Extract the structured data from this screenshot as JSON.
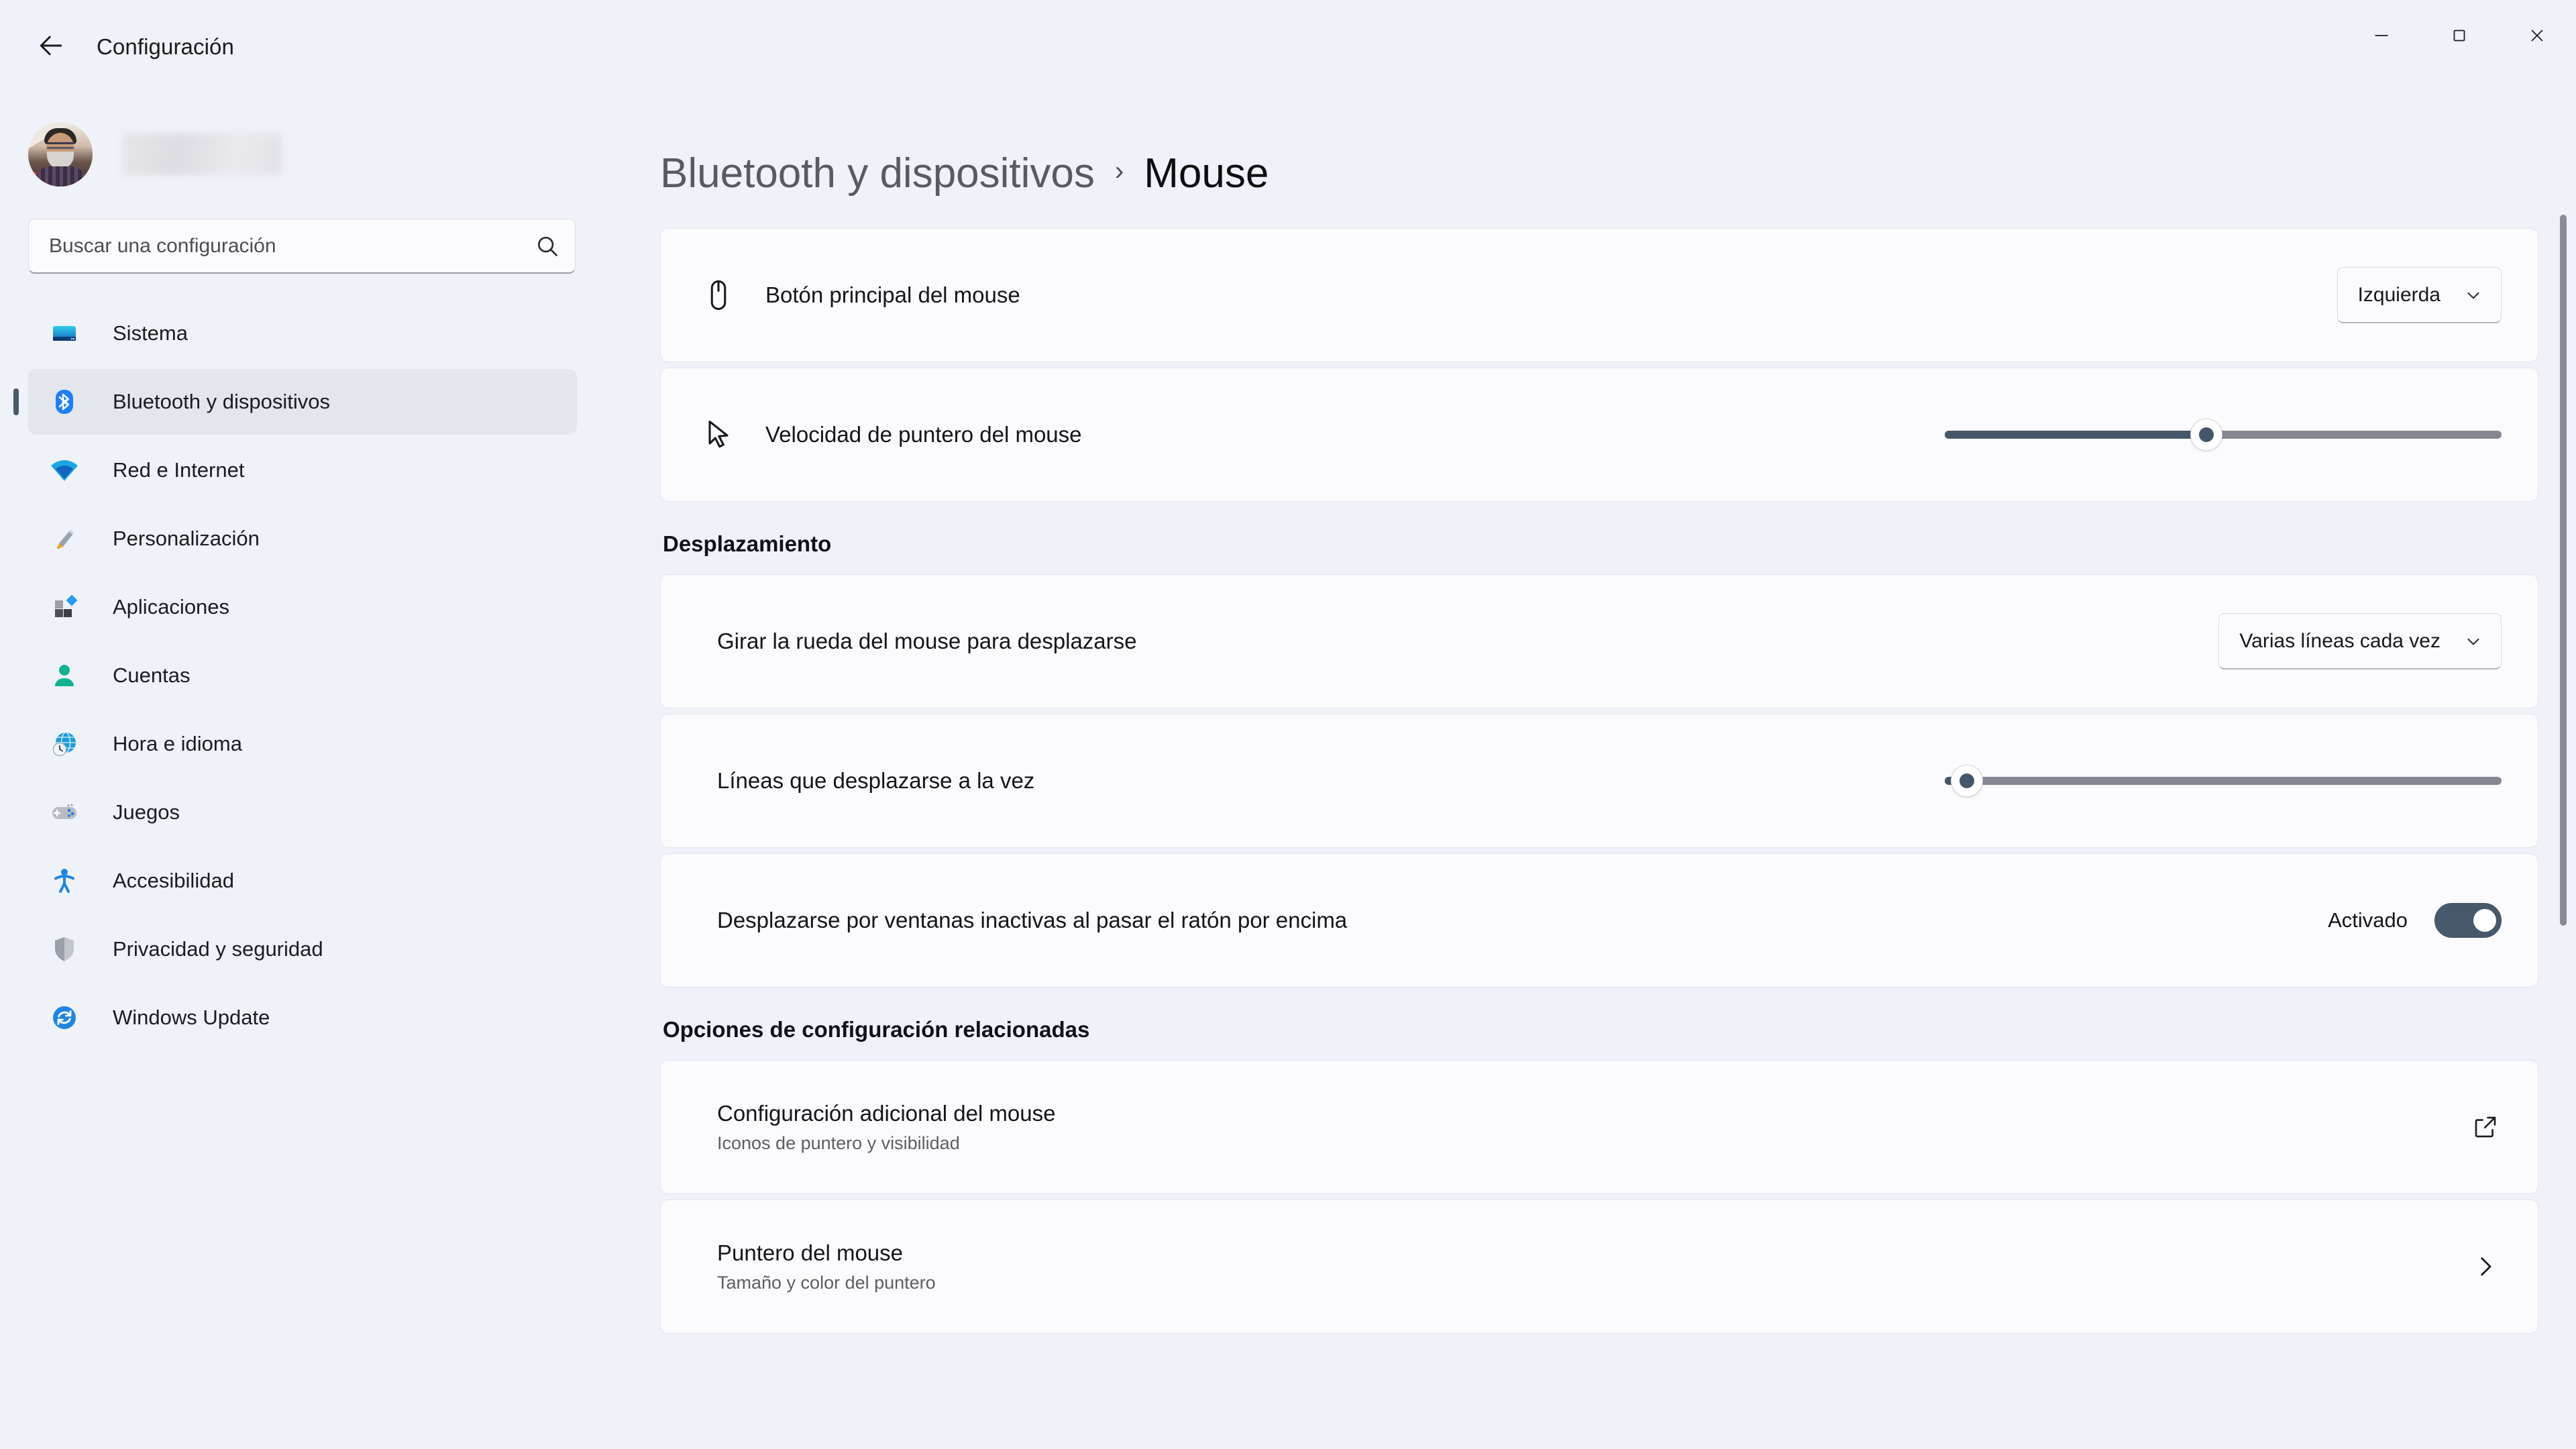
{
  "window": {
    "app_title": "Configuración",
    "back_icon": "arrow-left-icon",
    "controls": {
      "minimize": "minimize-icon",
      "maximize": "maximize-icon",
      "close": "close-icon"
    }
  },
  "sidebar": {
    "profile": {
      "avatar": "user-avatar",
      "name_redacted": ""
    },
    "search": {
      "placeholder": "Buscar una configuración",
      "value": "",
      "icon": "search-icon"
    },
    "items": [
      {
        "label": "Sistema",
        "icon": "system-monitor-icon",
        "active": false
      },
      {
        "label": "Bluetooth y dispositivos",
        "icon": "bluetooth-icon",
        "active": true
      },
      {
        "label": "Red e Internet",
        "icon": "wifi-icon",
        "active": false
      },
      {
        "label": "Personalización",
        "icon": "paintbrush-icon",
        "active": false
      },
      {
        "label": "Aplicaciones",
        "icon": "apps-icon",
        "active": false
      },
      {
        "label": "Cuentas",
        "icon": "account-person-icon",
        "active": false
      },
      {
        "label": "Hora e idioma",
        "icon": "clock-globe-icon",
        "active": false
      },
      {
        "label": "Juegos",
        "icon": "gamepad-icon",
        "active": false
      },
      {
        "label": "Accesibilidad",
        "icon": "accessibility-person-icon",
        "active": false
      },
      {
        "label": "Privacidad y seguridad",
        "icon": "shield-icon",
        "active": false
      },
      {
        "label": "Windows Update",
        "icon": "update-refresh-icon",
        "active": false
      }
    ]
  },
  "main": {
    "breadcrumb": {
      "parent": "Bluetooth y dispositivos",
      "separator": "›",
      "current": "Mouse"
    },
    "primary_button": {
      "label": "Botón principal del mouse",
      "icon": "mouse-icon",
      "dropdown_value": "Izquierda",
      "dropdown_icon": "chevron-down-icon"
    },
    "pointer_speed": {
      "label": "Velocidad de puntero del mouse",
      "icon": "cursor-arrow-icon",
      "slider_percent": 47
    },
    "scroll_section": {
      "title": "Desplazamiento",
      "wheel_scroll": {
        "label": "Girar la rueda del mouse para desplazarse",
        "dropdown_value": "Varias líneas cada vez",
        "dropdown_icon": "chevron-down-icon"
      },
      "lines_at_a_time": {
        "label": "Líneas que desplazarse a la vez",
        "slider_percent": 4
      },
      "inactive_windows": {
        "label": "Desplazarse por ventanas inactivas al pasar el ratón por encima",
        "toggle_state_label": "Activado",
        "toggle_on": true
      }
    },
    "related_section": {
      "title": "Opciones de configuración relacionadas",
      "items": [
        {
          "title": "Configuración adicional del mouse",
          "subtitle": "Iconos de puntero y visibilidad",
          "trailing_icon": "external-link-icon"
        },
        {
          "title": "Puntero del mouse",
          "subtitle": "Tamaño y color del puntero",
          "trailing_icon": "chevron-right-icon"
        }
      ]
    }
  },
  "colors": {
    "accent_slate": "#46586a",
    "window_bg": "#eff2f8",
    "card_bg": "#fbfbfd",
    "bluetooth_blue": "#2e80ed"
  }
}
